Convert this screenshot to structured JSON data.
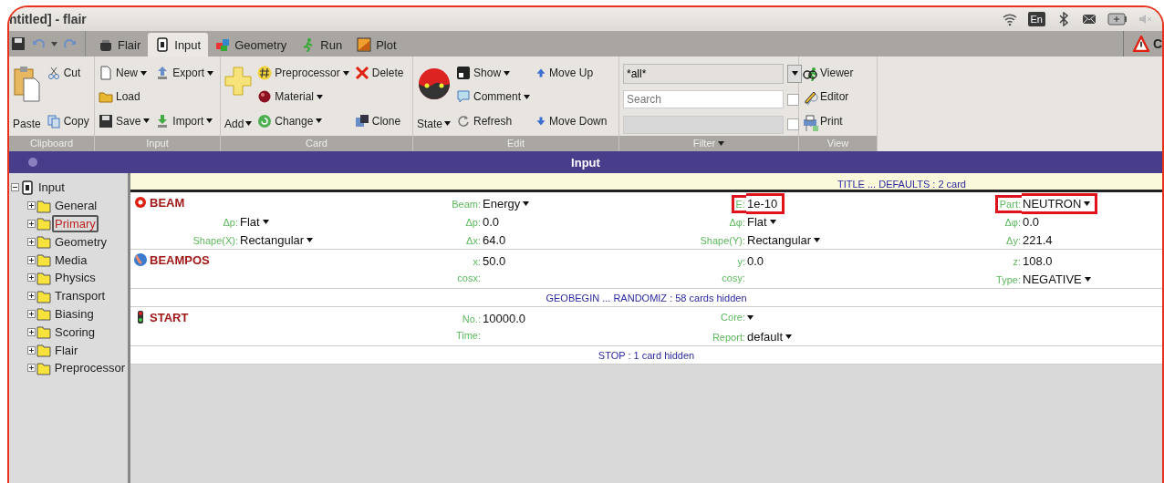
{
  "window": {
    "title": "ntitled] - flair"
  },
  "tray": {
    "language": "En"
  },
  "tabs": [
    {
      "label": "Flair",
      "selected": false
    },
    {
      "label": "Input",
      "selected": true
    },
    {
      "label": "Geometry",
      "selected": false
    },
    {
      "label": "Run",
      "selected": false
    },
    {
      "label": "Plot",
      "selected": false
    }
  ],
  "tab_bar_right": "C",
  "ribbon": [
    {
      "kind": "buttons",
      "label": "Clipboard",
      "large": {
        "label": "Paste",
        "dropdown": false
      },
      "columns": [
        [
          {
            "label": "Cut",
            "dropdown": false
          },
          {
            "label": "Copy",
            "dropdown": false
          }
        ]
      ]
    },
    {
      "kind": "buttons",
      "label": "Input",
      "columns": [
        [
          {
            "label": "New",
            "dropdown": true
          },
          {
            "label": "Load",
            "dropdown": false
          },
          {
            "label": "Save",
            "dropdown": true
          }
        ],
        [
          {
            "label": "Export",
            "dropdown": true
          },
          {
            "label": "Import",
            "dropdown": true
          }
        ]
      ]
    },
    {
      "kind": "buttons",
      "label": "Card",
      "large": {
        "label": "Add",
        "dropdown": true
      },
      "columns": [
        [
          {
            "label": "Preprocessor",
            "dropdown": true
          },
          {
            "label": "Material",
            "dropdown": true
          },
          {
            "label": "Change",
            "dropdown": true
          }
        ],
        [
          {
            "label": "Delete",
            "dropdown": false
          },
          {
            "label": "Clone",
            "dropdown": false
          }
        ]
      ]
    },
    {
      "kind": "buttons",
      "label": "Edit",
      "large": {
        "label": "State",
        "dropdown": true
      },
      "columns": [
        [
          {
            "label": "Show",
            "dropdown": true
          },
          {
            "label": "Comment",
            "dropdown": true
          },
          {
            "label": "Refresh",
            "dropdown": false
          }
        ],
        [
          {
            "label": "Move Up",
            "dropdown": false
          },
          {
            "label": "Move Down",
            "dropdown": false
          }
        ]
      ]
    },
    {
      "kind": "filter",
      "label": "Filter",
      "dropdown": true,
      "combo": "*all*",
      "search_placeholder": "Search",
      "checkboxes": [
        {
          "checked": false
        },
        {
          "checked": false
        }
      ]
    },
    {
      "kind": "buttons",
      "label": "View",
      "columns": [
        [
          {
            "label": "Viewer",
            "dropdown": false
          },
          {
            "label": "Editor",
            "dropdown": false
          },
          {
            "label": "Print",
            "dropdown": false
          }
        ]
      ]
    }
  ],
  "panel_title": "Input",
  "tree": {
    "label": "Input",
    "expanded": true,
    "selected": false,
    "children": [
      {
        "label": "General",
        "expanded": false,
        "selected": false
      },
      {
        "label": "Primary",
        "expanded": false,
        "selected": true
      },
      {
        "label": "Geometry",
        "expanded": false,
        "selected": false
      },
      {
        "label": "Media",
        "expanded": false,
        "selected": false
      },
      {
        "label": "Physics",
        "expanded": false,
        "selected": false
      },
      {
        "label": "Transport",
        "expanded": false,
        "selected": false
      },
      {
        "label": "Biasing",
        "expanded": false,
        "selected": false
      },
      {
        "label": "Scoring",
        "expanded": false,
        "selected": false
      },
      {
        "label": "Flair",
        "expanded": false,
        "selected": false
      },
      {
        "label": "Preprocessor",
        "expanded": false,
        "selected": false
      }
    ]
  },
  "cards": [
    {
      "kind": "header",
      "label": "TITLE ... DEFAULTS : 2 card"
    },
    {
      "kind": "card",
      "name": "BEAM",
      "lines": [
        {
          "column_2": {
            "label": "Beam:",
            "value": "Energy",
            "dropdown": true,
            "highlighted": false
          },
          "column_3": {
            "label": "E:",
            "value": "1e-10",
            "dropdown": false,
            "highlighted": true
          },
          "column_4": {
            "label": "Part:",
            "value": "NEUTRON",
            "dropdown": true,
            "highlighted": true
          }
        },
        {
          "column_1": {
            "label": "Δp:",
            "value": "Flat",
            "dropdown": true,
            "highlighted": false
          },
          "column_2": {
            "label": "Δp:",
            "value": "0.0",
            "dropdown": false,
            "highlighted": false
          },
          "column_3": {
            "label": "Δφ:",
            "value": "Flat",
            "dropdown": true,
            "highlighted": false
          },
          "column_4": {
            "label": "Δφ:",
            "value": "0.0",
            "dropdown": false,
            "highlighted": false
          }
        },
        {
          "column_1": {
            "label": "Shape(X):",
            "value": "Rectangular",
            "dropdown": true,
            "highlighted": false
          },
          "column_2": {
            "label": "Δx:",
            "value": "64.0",
            "dropdown": false,
            "highlighted": false
          },
          "column_3": {
            "label": "Shape(Y):",
            "value": "Rectangular",
            "dropdown": true,
            "highlighted": false
          },
          "column_4": {
            "label": "Δy:",
            "value": "221.4",
            "dropdown": false,
            "highlighted": false
          }
        }
      ]
    },
    {
      "kind": "card",
      "name": "BEAMPOS",
      "lines": [
        {
          "column_2": {
            "label": "x:",
            "value": "50.0",
            "dropdown": false,
            "highlighted": false
          },
          "column_3": {
            "label": "y:",
            "value": "0.0",
            "dropdown": false,
            "highlighted": false
          },
          "column_4": {
            "label": "z:",
            "value": "108.0",
            "dropdown": false,
            "highlighted": false
          }
        },
        {
          "column_2": {
            "label": "cosx:",
            "dropdown": false,
            "highlighted": false
          },
          "column_3": {
            "label": "cosy:",
            "dropdown": false,
            "highlighted": false
          },
          "column_4": {
            "label": "Type:",
            "value": "NEGATIVE",
            "dropdown": true,
            "highlighted": false
          }
        }
      ]
    },
    {
      "kind": "separator",
      "label": "GEOBEGIN ... RANDOMIZ : 58 cards hidden"
    },
    {
      "kind": "card",
      "name": "START",
      "lines": [
        {
          "column_2": {
            "label": "No.:",
            "value": "10000.0",
            "dropdown": false,
            "highlighted": false
          },
          "column_3": {
            "label": "Core:",
            "dropdown": true,
            "highlighted": false
          }
        },
        {
          "column_2": {
            "label": "Time:",
            "dropdown": false,
            "highlighted": false
          },
          "column_3": {
            "label": "Report:",
            "value": "default",
            "dropdown": true,
            "highlighted": false
          }
        }
      ]
    },
    {
      "kind": "separator",
      "label": "STOP : 1 card hidden"
    }
  ]
}
